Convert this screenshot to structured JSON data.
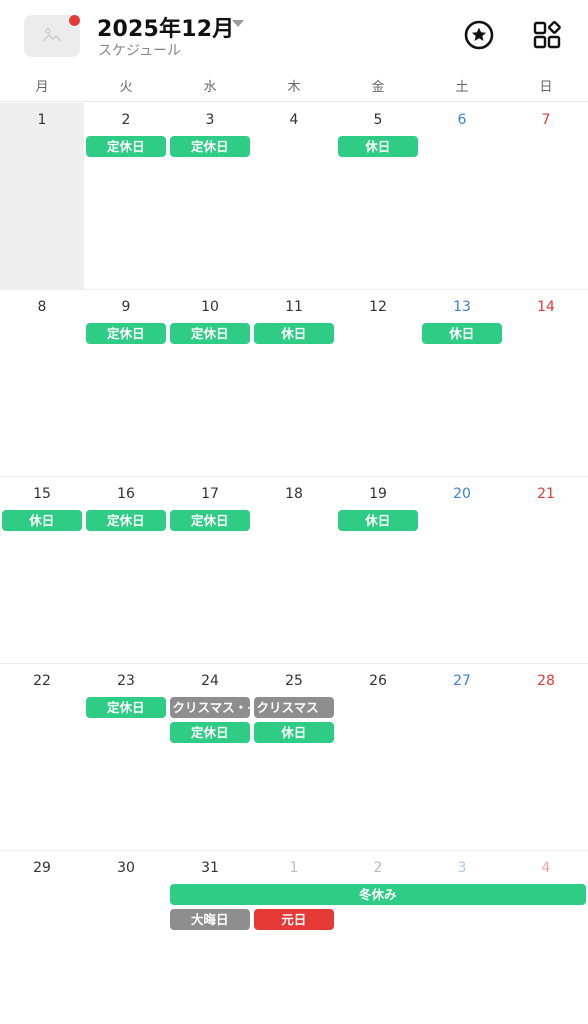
{
  "header": {
    "title": "2025年12月",
    "subtitle": "スケジュール",
    "thumbnail_icon": "image-placeholder-icon",
    "notification_color": "#e53935",
    "favorite_icon": "star-circle-icon",
    "apps_icon": "widgets-icon"
  },
  "weekdays": [
    "月",
    "火",
    "水",
    "木",
    "金",
    "土",
    "日"
  ],
  "colors": {
    "event_green": "#2ecc85",
    "event_gray": "#8e8e8e",
    "event_red": "#e53935",
    "saturday": "#3b7fd9",
    "sunday": "#e53935"
  },
  "weeks": [
    {
      "days": [
        {
          "num": "1",
          "today": true
        },
        {
          "num": "2"
        },
        {
          "num": "3"
        },
        {
          "num": "4"
        },
        {
          "num": "5"
        },
        {
          "num": "6",
          "type": "sat"
        },
        {
          "num": "7",
          "type": "sun"
        }
      ],
      "events": [
        {
          "label": "定休日",
          "start": 1,
          "span": 1,
          "row": 0,
          "color": "green"
        },
        {
          "label": "定休日",
          "start": 2,
          "span": 1,
          "row": 0,
          "color": "green"
        },
        {
          "label": "休日",
          "start": 4,
          "span": 1,
          "row": 0,
          "color": "green"
        }
      ]
    },
    {
      "days": [
        {
          "num": "8"
        },
        {
          "num": "9"
        },
        {
          "num": "10"
        },
        {
          "num": "11"
        },
        {
          "num": "12"
        },
        {
          "num": "13",
          "type": "sat"
        },
        {
          "num": "14",
          "type": "sun"
        }
      ],
      "events": [
        {
          "label": "定休日",
          "start": 1,
          "span": 1,
          "row": 0,
          "color": "green"
        },
        {
          "label": "定休日",
          "start": 2,
          "span": 1,
          "row": 0,
          "color": "green"
        },
        {
          "label": "休日",
          "start": 3,
          "span": 1,
          "row": 0,
          "color": "green"
        },
        {
          "label": "休日",
          "start": 5,
          "span": 1,
          "row": 0,
          "color": "green"
        }
      ]
    },
    {
      "days": [
        {
          "num": "15"
        },
        {
          "num": "16"
        },
        {
          "num": "17"
        },
        {
          "num": "18"
        },
        {
          "num": "19"
        },
        {
          "num": "20",
          "type": "sat"
        },
        {
          "num": "21",
          "type": "sun"
        }
      ],
      "events": [
        {
          "label": "休日",
          "start": 0,
          "span": 1,
          "row": 0,
          "color": "green"
        },
        {
          "label": "定休日",
          "start": 1,
          "span": 1,
          "row": 0,
          "color": "green"
        },
        {
          "label": "定休日",
          "start": 2,
          "span": 1,
          "row": 0,
          "color": "green"
        },
        {
          "label": "休日",
          "start": 4,
          "span": 1,
          "row": 0,
          "color": "green"
        }
      ]
    },
    {
      "days": [
        {
          "num": "22"
        },
        {
          "num": "23"
        },
        {
          "num": "24"
        },
        {
          "num": "25"
        },
        {
          "num": "26"
        },
        {
          "num": "27",
          "type": "sat"
        },
        {
          "num": "28",
          "type": "sun"
        }
      ],
      "events": [
        {
          "label": "定休日",
          "start": 1,
          "span": 1,
          "row": 0,
          "color": "green"
        },
        {
          "label": "クリスマス・イブ",
          "start": 2,
          "span": 1,
          "row": 0,
          "color": "gray",
          "clip": true
        },
        {
          "label": "クリスマス",
          "start": 3,
          "span": 1,
          "row": 0,
          "color": "gray",
          "clip": true
        },
        {
          "label": "定休日",
          "start": 2,
          "span": 1,
          "row": 1,
          "color": "green"
        },
        {
          "label": "休日",
          "start": 3,
          "span": 1,
          "row": 1,
          "color": "green"
        }
      ]
    },
    {
      "days": [
        {
          "num": "29"
        },
        {
          "num": "30"
        },
        {
          "num": "31"
        },
        {
          "num": "1",
          "type": "other"
        },
        {
          "num": "2",
          "type": "other"
        },
        {
          "num": "3",
          "type": "other sat"
        },
        {
          "num": "4",
          "type": "other sun"
        }
      ],
      "events": [
        {
          "label": "冬休み",
          "start": 2,
          "span": 5,
          "row": 0,
          "color": "green"
        },
        {
          "label": "大晦日",
          "start": 2,
          "span": 1,
          "row": 1,
          "color": "gray"
        },
        {
          "label": "元日",
          "start": 3,
          "span": 1,
          "row": 1,
          "color": "red"
        }
      ]
    }
  ]
}
